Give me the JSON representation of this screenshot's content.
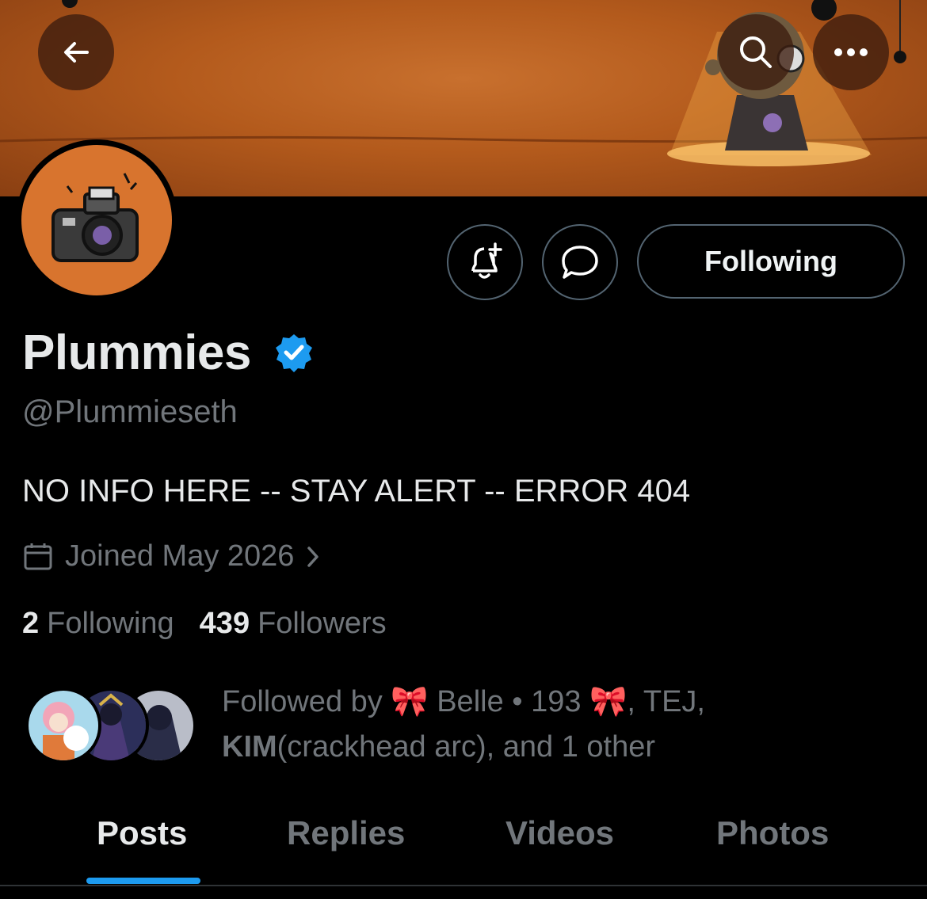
{
  "header": {
    "back_icon": "arrow-left-icon",
    "search_icon": "search-icon",
    "more_icon": "more-horizontal-icon"
  },
  "actions": {
    "notify_icon": "bell-plus-icon",
    "message_icon": "message-icon",
    "following_label": "Following"
  },
  "profile": {
    "display_name": "Plummies",
    "verified_icon": "verified-badge-icon",
    "handle": "@Plummieseth",
    "bio": "NO INFO HERE -- STAY ALERT -- ERROR 404",
    "joined": "Joined May 2026",
    "following_count": "2",
    "following_label": "Following",
    "followers_count": "439",
    "followers_label": "Followers"
  },
  "followed_by": {
    "prefix": "Followed by ",
    "name_1": " Belle • 193 ",
    "sep_1": ", TEJ,",
    "name_2": "KIM",
    "name_2_suffix": "(crackhead arc), and 1 other",
    "ribbon_emoji": "🎀"
  },
  "tabs": {
    "items": [
      "Posts",
      "Replies",
      "Videos",
      "Photos"
    ],
    "active": "Posts"
  },
  "colors": {
    "accent": "#1d9bf0",
    "verified": "#1d9bf0",
    "banner": "#b35a1c"
  }
}
